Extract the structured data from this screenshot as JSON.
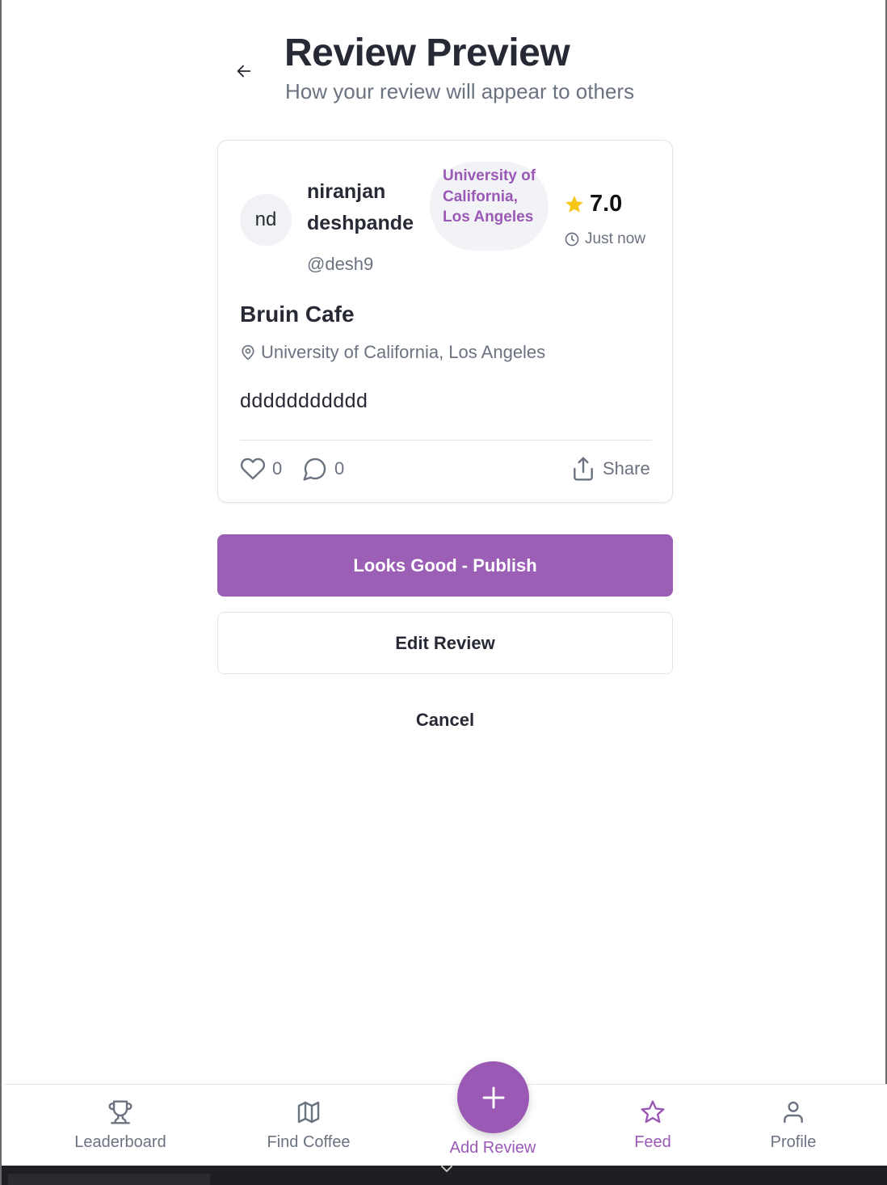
{
  "header": {
    "title": "Review Preview",
    "subtitle": "How your review will appear to others",
    "back_icon": "arrow-left-icon"
  },
  "review": {
    "avatar_initials": "nd",
    "user_name": "niranjan deshpande",
    "user_handle": "@desh9",
    "school_badge": "University of California, Los Angeles",
    "rating": "7.0",
    "timestamp": "Just now",
    "cafe_name": "Bruin Cafe",
    "location": "University of California, Los Angeles",
    "text": "ddddddddddd",
    "likes": "0",
    "comments": "0",
    "share_label": "Share"
  },
  "actions": {
    "publish_label": "Looks Good - Publish",
    "edit_label": "Edit Review",
    "cancel_label": "Cancel"
  },
  "tabbar": {
    "items": [
      {
        "label": "Leaderboard",
        "icon": "trophy-icon"
      },
      {
        "label": "Find Coffee",
        "icon": "map-icon"
      },
      {
        "label": "Add Review",
        "icon": "plus-icon"
      },
      {
        "label": "Feed",
        "icon": "star-icon",
        "active": true
      },
      {
        "label": "Profile",
        "icon": "user-icon"
      }
    ]
  },
  "colors": {
    "accent": "#9b59b6",
    "star": "#f5c518",
    "text": "#272a35",
    "muted": "#6b7280"
  }
}
